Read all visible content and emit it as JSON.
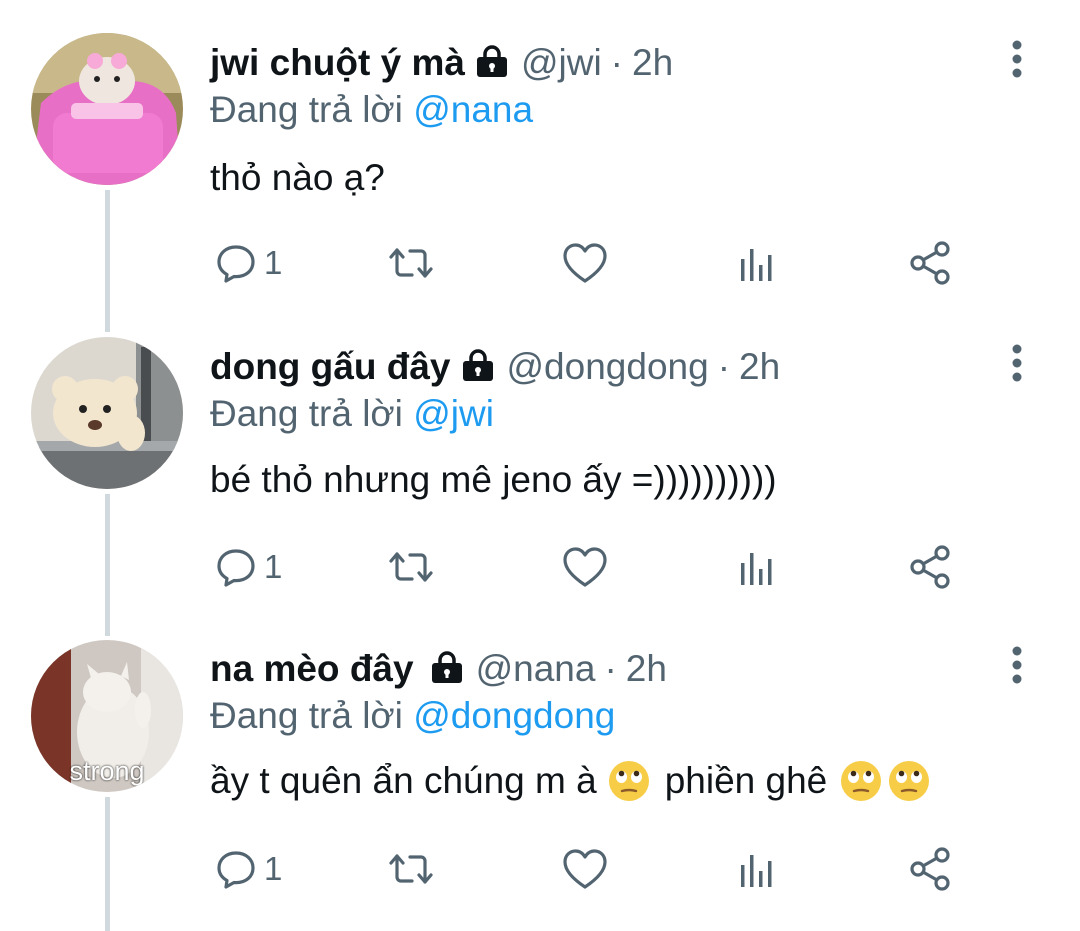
{
  "tweets": [
    {
      "name": "jwi chuột ý mà",
      "handle": "@jwi",
      "dot": "·",
      "time": "2h",
      "reply_prefix": "Đang trả lời",
      "reply_to": "@nana",
      "text_parts": [
        "thỏ nào ạ?"
      ],
      "reply_count": "1",
      "avatar": {
        "label": "",
        "colors": [
          "#b3a172",
          "#e96fc4"
        ]
      }
    },
    {
      "name": "dong gấu đây",
      "handle": "@dongdong",
      "dot": "·",
      "time": "2h",
      "reply_prefix": "Đang trả lời",
      "reply_to": "@jwi",
      "text_parts": [
        "bé thỏ nhưng mê jeno ấy =))))))))))"
      ],
      "reply_count": "1",
      "avatar": {
        "label": "",
        "colors": [
          "#e6e2da",
          "#f2dfc4"
        ]
      }
    },
    {
      "name": "na mèo đây",
      "handle": "@nana",
      "dot": "·",
      "time": "2h",
      "reply_prefix": "Đang trả lời",
      "reply_to": "@dongdong",
      "text_parts": [
        "ầy t quên ẩn chúng m à",
        "phiền ghê"
      ],
      "reply_count": "1",
      "avatar": {
        "label": "strong",
        "colors": [
          "#8a4a3a",
          "#d9d3cd"
        ]
      }
    }
  ],
  "icons": {
    "lock": "lock-icon",
    "more": "more-vertical-icon",
    "reply": "reply-icon",
    "retweet": "retweet-icon",
    "like": "heart-icon",
    "views": "analytics-icon",
    "share": "share-icon",
    "emoji": "face-with-rolling-eyes-emoji"
  },
  "colors": {
    "accent": "#1d9bf0",
    "secondary": "#536471",
    "primary": "#0f1419",
    "thread": "#cfd9de"
  }
}
